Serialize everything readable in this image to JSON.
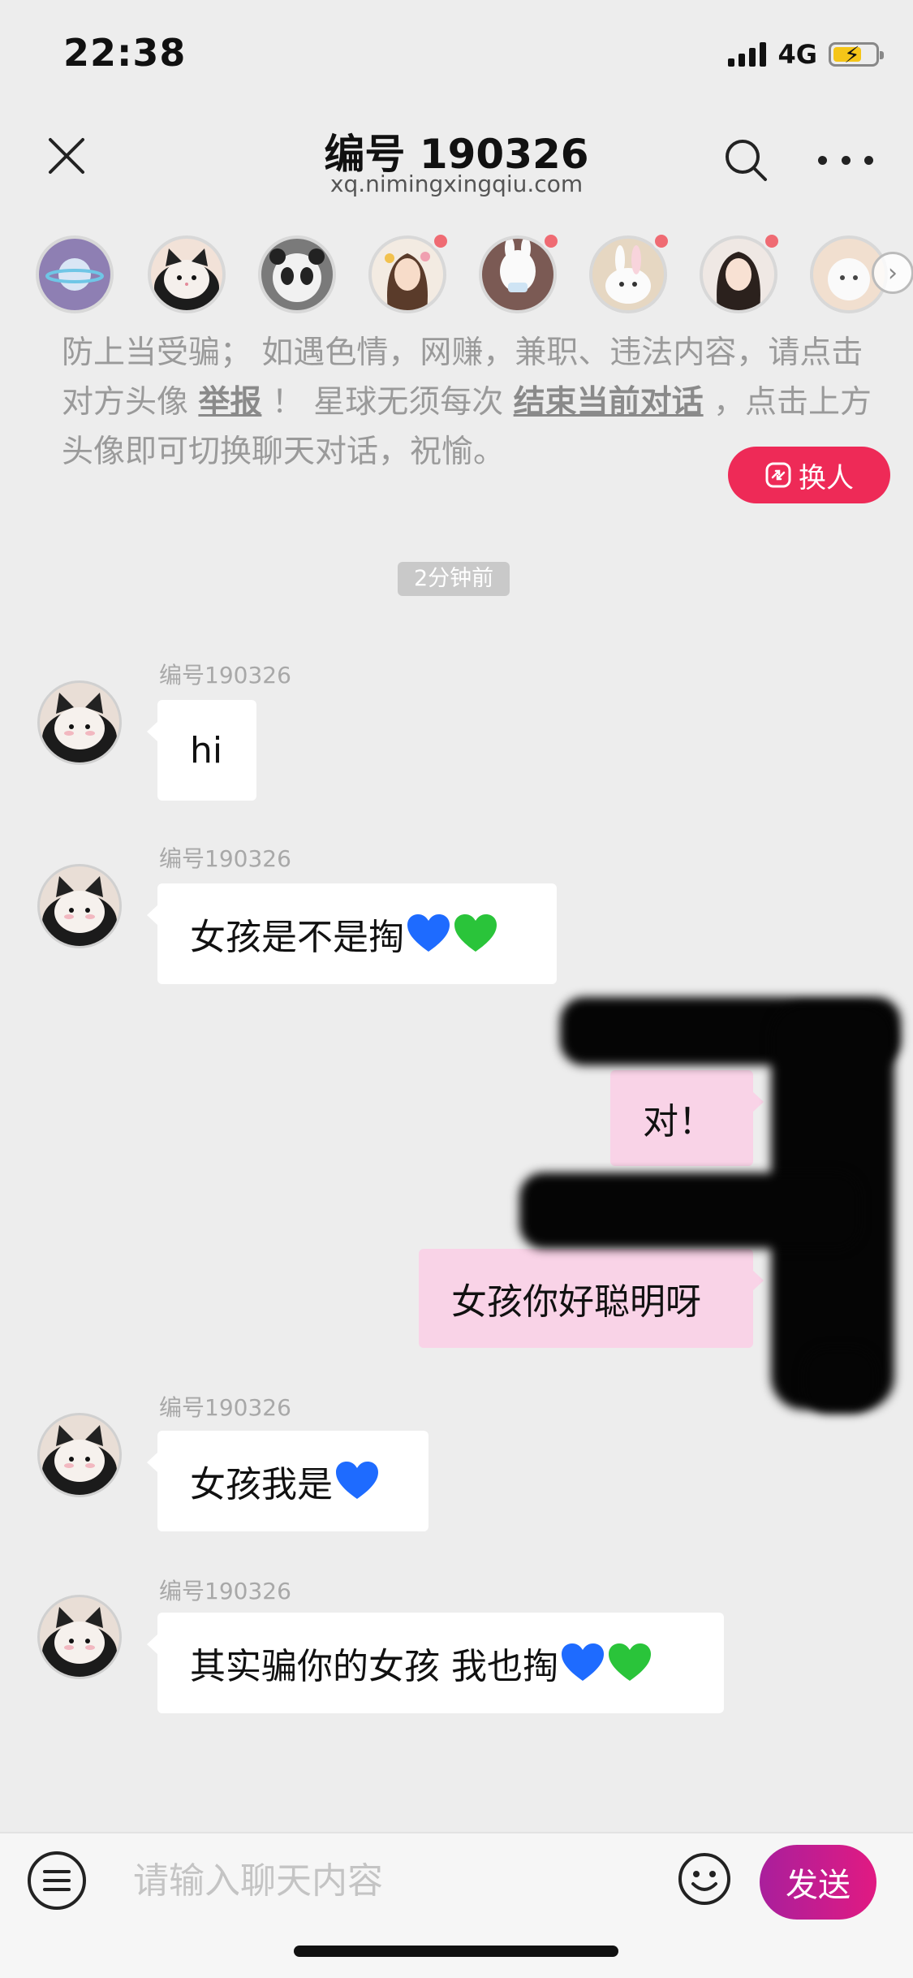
{
  "status_bar": {
    "time": "22:38",
    "network": "4G"
  },
  "header": {
    "title": "编号 190326",
    "domain": "xq.nimingxingqiu.com"
  },
  "strip": {
    "avatars": [
      {
        "name": "planet-avatar",
        "unread": false
      },
      {
        "name": "cat-avatar",
        "unread": false
      },
      {
        "name": "panda-avatar",
        "unread": false
      },
      {
        "name": "girl-flower-avatar",
        "unread": true
      },
      {
        "name": "bunny-hat-avatar",
        "unread": true
      },
      {
        "name": "rabbit-avatar",
        "unread": true
      },
      {
        "name": "girl-avatar",
        "unread": true
      },
      {
        "name": "cartoon-avatar",
        "unread": false
      }
    ]
  },
  "notice": {
    "text1": "防上当受骗； 如遇色情，网赚，兼职、违法内容，请点击对方头像 ",
    "link_report": "举报",
    "text2": " ！  星球无须每次 ",
    "link_end": "结束当前对话",
    "text3": " ，点击上方头像即可切换聊天对话，祝愉。",
    "swap_label": "换人"
  },
  "timestamp": "2分钟前",
  "messages": [
    {
      "sender": "编号190326",
      "text": "hi"
    },
    {
      "sender": "编号190326",
      "text": "女孩是不是掏"
    },
    {
      "text": "对！"
    },
    {
      "text": "女孩你好聪明呀"
    },
    {
      "sender": "编号190326",
      "text": "女孩我是"
    },
    {
      "sender": "编号190326",
      "text": "其实骗你的女孩 我也掏"
    }
  ],
  "input": {
    "placeholder": "请输入聊天内容",
    "send_label": "发送"
  },
  "colors": {
    "accent": "#ee2a57",
    "outgoing_bubble": "#f9d3e7",
    "send_gradient": [
      "#a91f9c",
      "#e11a82"
    ],
    "blue_heart": "#1e6bff",
    "green_heart": "#2ac43a"
  }
}
